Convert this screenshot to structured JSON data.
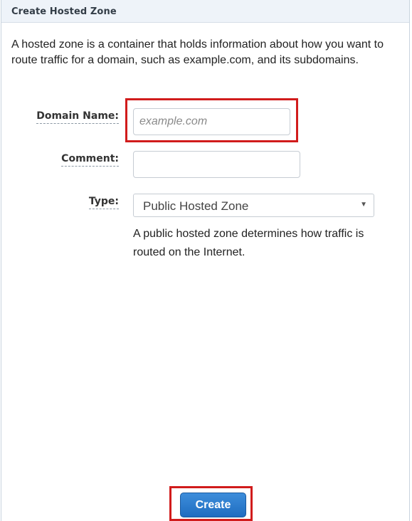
{
  "panel": {
    "title": "Create Hosted Zone",
    "description": "A hosted zone is a container that holds information about how you want to route traffic for a domain, such as example.com, and its subdomains."
  },
  "form": {
    "domain_name": {
      "label": "Domain Name:",
      "placeholder": "example.com",
      "value": ""
    },
    "comment": {
      "label": "Comment:",
      "placeholder": "",
      "value": ""
    },
    "type": {
      "label": "Type:",
      "selected": "Public Hosted Zone",
      "help": "A public hosted zone determines how traffic is routed on the Internet."
    }
  },
  "actions": {
    "create_label": "Create"
  },
  "colors": {
    "header_bg": "#eef3f9",
    "highlight": "#d11c1c",
    "primary_button": "#1f6cc0"
  },
  "icons": {
    "select_arrow": "chevron-down-icon"
  }
}
